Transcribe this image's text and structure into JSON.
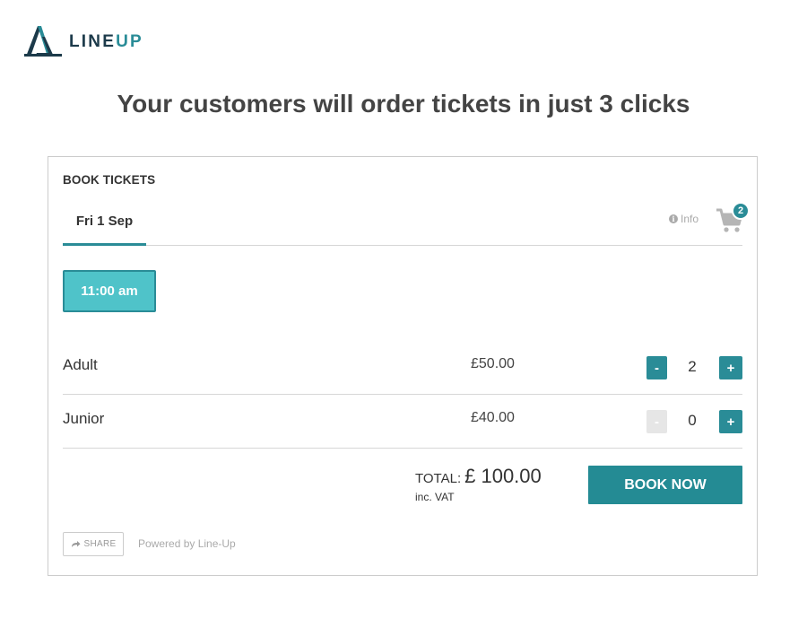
{
  "logo": {
    "text_primary": "LINE",
    "text_accent": "UP"
  },
  "headline": "Your customers will order tickets in just 3 clicks",
  "widget": {
    "title": "BOOK TICKETS",
    "date_tab": "Fri 1 Sep",
    "info_label": "Info",
    "cart_count": "2",
    "time_slot": "11:00 am",
    "tickets": [
      {
        "name": "Adult",
        "price": "£50.00",
        "quantity": "2",
        "minus": "-",
        "plus": "+"
      },
      {
        "name": "Junior",
        "price": "£40.00",
        "quantity": "0",
        "minus": "-",
        "plus": "+"
      }
    ],
    "total_label": "TOTAL:",
    "total_amount": "£ 100.00",
    "total_note": "inc. VAT",
    "book_button": "BOOK NOW",
    "share_button": "SHARE",
    "powered_by": "Powered by Line-Up"
  },
  "colors": {
    "accent": "#2a8c97",
    "slot_fill": "#4fc3c9",
    "logo_dark": "#1c3a4a"
  }
}
